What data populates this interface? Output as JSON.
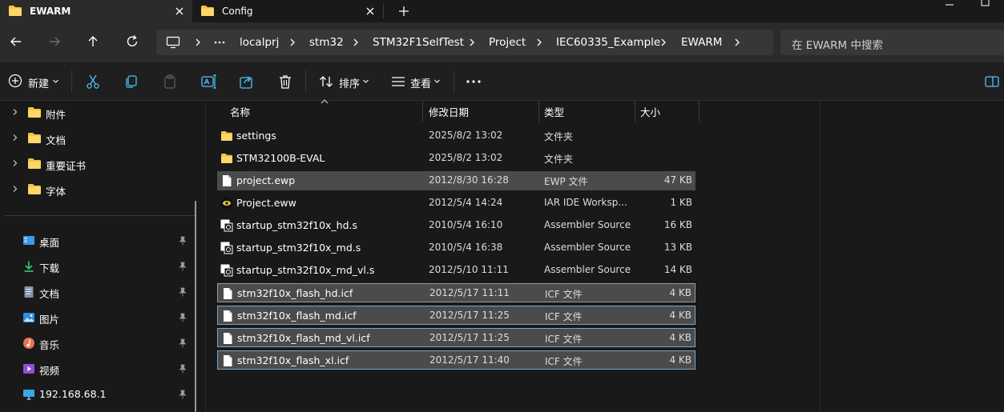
{
  "tabs": [
    {
      "label": "EWARM",
      "active": true
    },
    {
      "label": "Config",
      "active": false
    }
  ],
  "breadcrumb": [
    "localprj",
    "stm32",
    "STM32F1SelfTest",
    "Project",
    "IEC60335_Example",
    "EWARM"
  ],
  "search": {
    "placeholder": "在 EWARM 中搜索"
  },
  "toolbar": {
    "new_label": "新建",
    "sort_label": "排序",
    "view_label": "查看"
  },
  "sidebar": {
    "folders": [
      {
        "label": "附件"
      },
      {
        "label": "文档"
      },
      {
        "label": "重要证书"
      },
      {
        "label": "字体"
      }
    ],
    "quick_access": [
      {
        "label": "桌面",
        "icon": "desktop-icon"
      },
      {
        "label": "下载",
        "icon": "download-icon"
      },
      {
        "label": "文档",
        "icon": "document-icon"
      },
      {
        "label": "图片",
        "icon": "pictures-icon"
      },
      {
        "label": "音乐",
        "icon": "music-icon"
      },
      {
        "label": "视频",
        "icon": "videos-icon"
      },
      {
        "label": "192.168.68.1",
        "icon": "network-computer-icon"
      }
    ]
  },
  "columns": {
    "name": "名称",
    "date": "修改日期",
    "type": "类型",
    "size": "大小"
  },
  "files": [
    {
      "name": "settings",
      "date": "2025/8/2 13:02",
      "type": "文件夹",
      "size": "",
      "icon": "folder-icon"
    },
    {
      "name": "STM32100B-EVAL",
      "date": "2025/8/2 13:02",
      "type": "文件夹",
      "size": "",
      "icon": "folder-icon"
    },
    {
      "name": "project.ewp",
      "date": "2012/8/30 16:28",
      "type": "EWP 文件",
      "size": "47 KB",
      "icon": "file-icon"
    },
    {
      "name": "Project.eww",
      "date": "2012/5/4 14:24",
      "type": "IAR IDE Worksp...",
      "size": "1 KB",
      "icon": "iar-workspace-icon"
    },
    {
      "name": "startup_stm32f10x_hd.s",
      "date": "2010/5/4 16:10",
      "type": "Assembler Source",
      "size": "16 KB",
      "icon": "assembler-file-icon"
    },
    {
      "name": "startup_stm32f10x_md.s",
      "date": "2010/5/4 16:38",
      "type": "Assembler Source",
      "size": "13 KB",
      "icon": "assembler-file-icon"
    },
    {
      "name": "startup_stm32f10x_md_vl.s",
      "date": "2012/5/10 11:11",
      "type": "Assembler Source",
      "size": "14 KB",
      "icon": "assembler-file-icon"
    },
    {
      "name": "stm32f10x_flash_hd.icf",
      "date": "2012/5/17 11:11",
      "type": "ICF 文件",
      "size": "4 KB",
      "icon": "file-icon"
    },
    {
      "name": "stm32f10x_flash_md.icf",
      "date": "2012/5/17 11:25",
      "type": "ICF 文件",
      "size": "4 KB",
      "icon": "file-icon"
    },
    {
      "name": "stm32f10x_flash_md_vl.icf",
      "date": "2012/5/17 11:25",
      "type": "ICF 文件",
      "size": "4 KB",
      "icon": "file-icon"
    },
    {
      "name": "stm32f10x_flash_xl.icf",
      "date": "2012/5/17 11:40",
      "type": "ICF 文件",
      "size": "4 KB",
      "icon": "file-icon"
    }
  ],
  "colors": {
    "folder": "#f2c54a",
    "selection": "#4b4b4b",
    "selection_border": "#7aa6c6",
    "accent": "#4cc2ff"
  }
}
